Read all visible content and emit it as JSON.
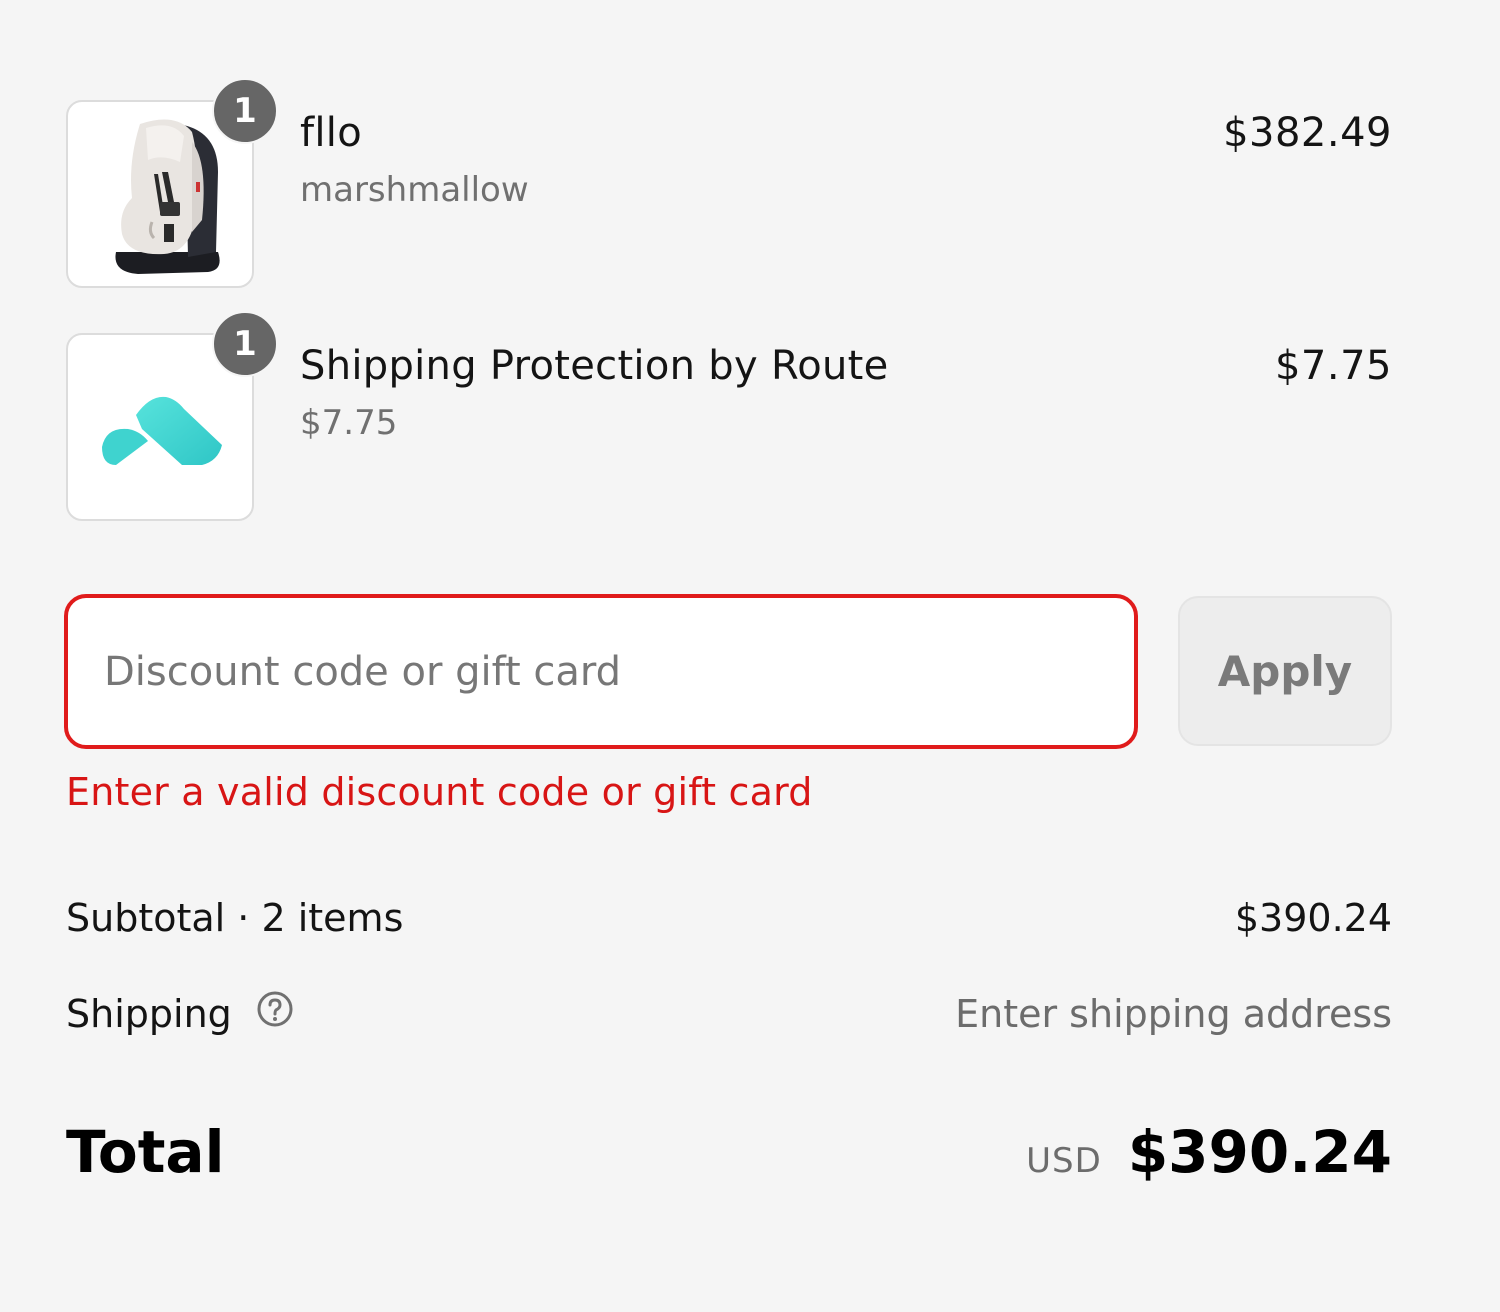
{
  "line_items": [
    {
      "name": "fllo",
      "variant": "marshmallow",
      "price": "$382.49",
      "quantity": "1",
      "image_icon": "car-seat-image"
    },
    {
      "name": "Shipping Protection by Route",
      "variant": "$7.75",
      "price": "$7.75",
      "quantity": "1",
      "image_icon": "route-logo"
    }
  ],
  "discount": {
    "placeholder": "Discount code or gift card",
    "value": "",
    "apply_label": "Apply",
    "error": "Enter a valid discount code or gift card"
  },
  "summary": {
    "subtotal_label": "Subtotal · 2 items",
    "subtotal_value": "$390.24",
    "shipping_label": "Shipping",
    "shipping_help_icon": "help-circle-icon",
    "shipping_value": "Enter shipping address",
    "total_label": "Total",
    "currency": "USD",
    "total_value": "$390.24"
  },
  "colors": {
    "error": "#e01b1b",
    "background": "#f5f5f5",
    "badge": "#666666",
    "route_teal": "#3fd3cf"
  }
}
